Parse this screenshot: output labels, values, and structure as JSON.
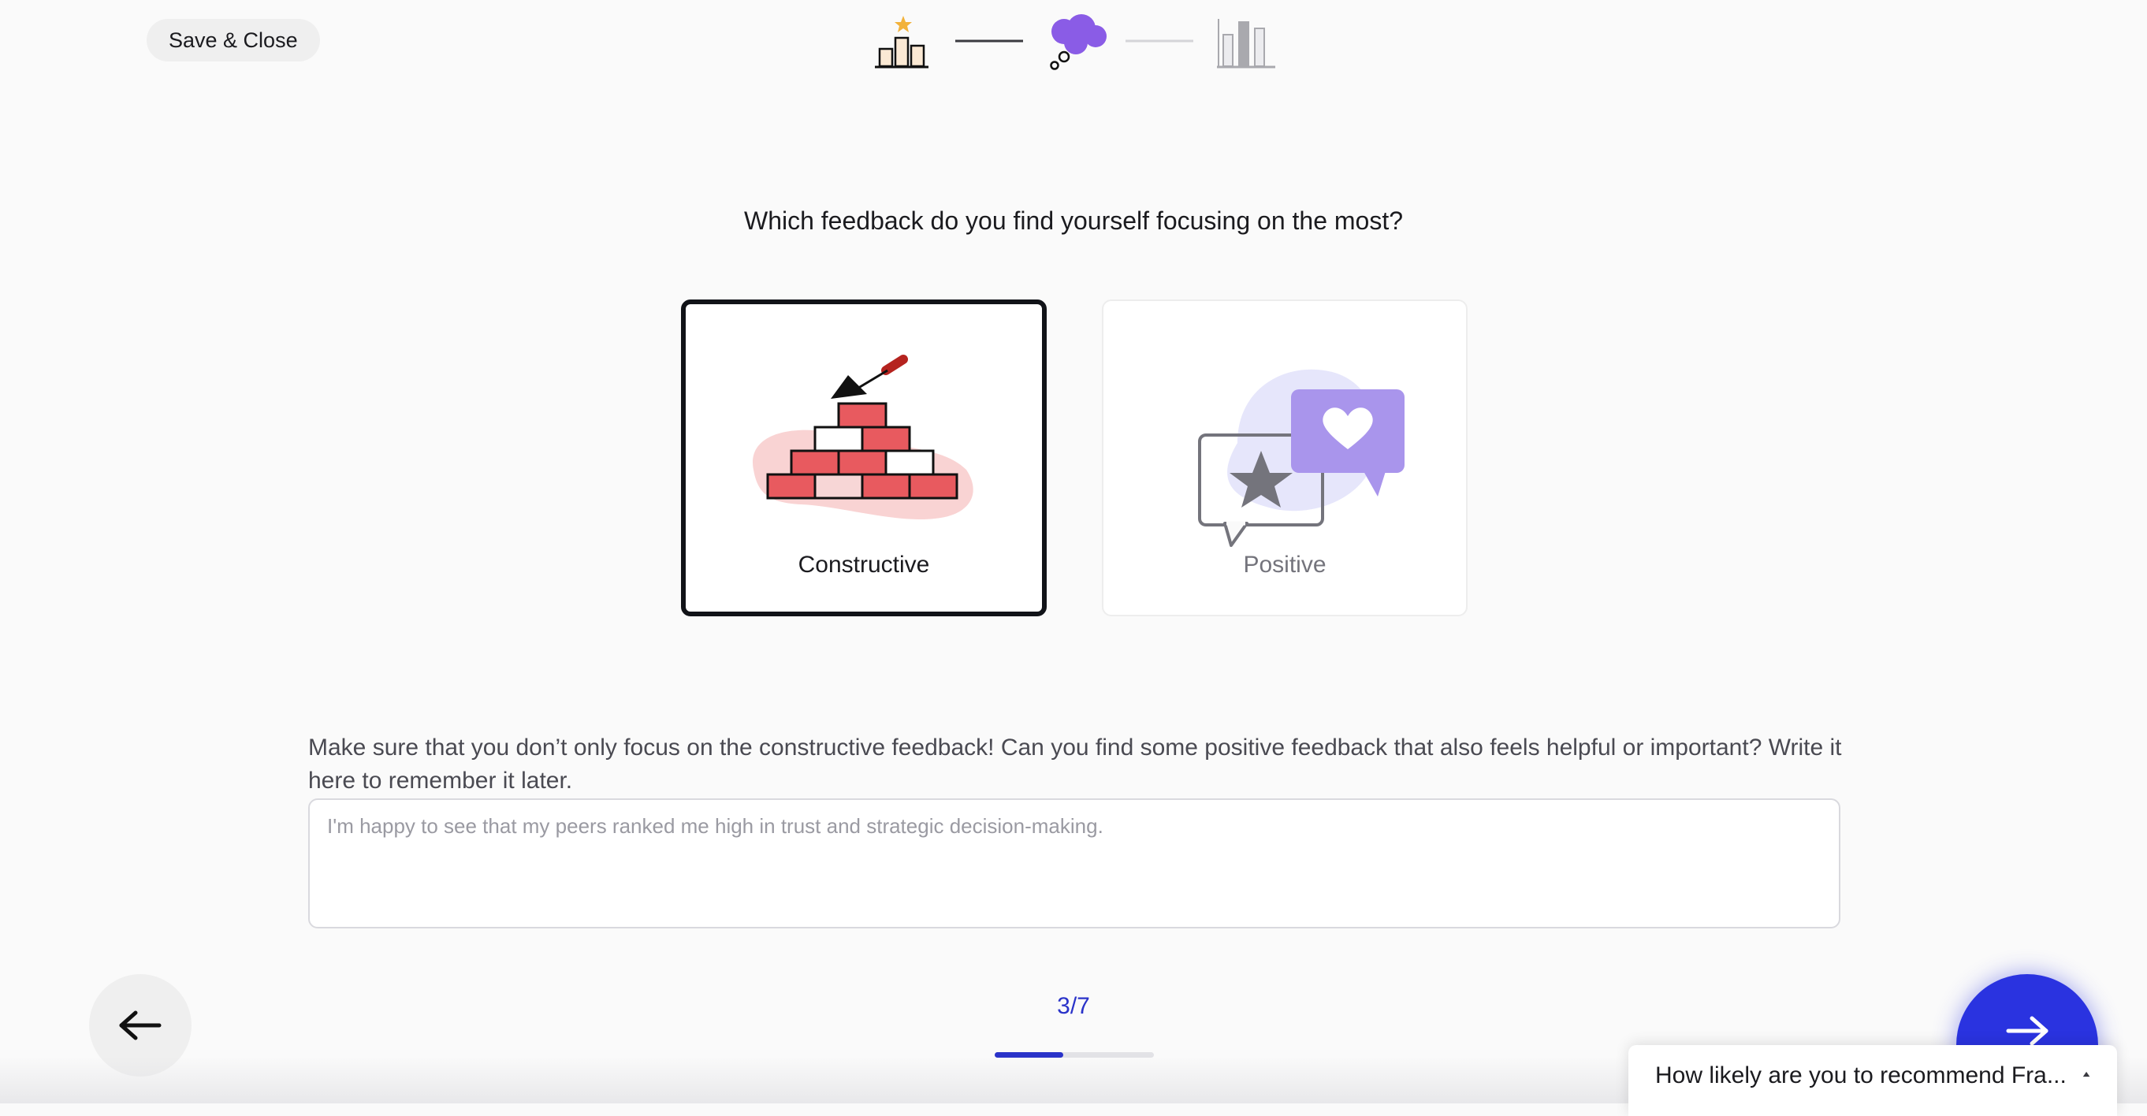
{
  "header": {
    "save_close_label": "Save & Close",
    "steps": [
      {
        "icon": "podium-star-icon",
        "state": "done"
      },
      {
        "icon": "thought-cloud-icon",
        "state": "current"
      },
      {
        "icon": "bar-chart-icon",
        "state": "upcoming"
      }
    ]
  },
  "question": "Which feedback do you find yourself focusing on the most?",
  "options": [
    {
      "label": "Constructive",
      "icon": "brick-wall-trowel-icon",
      "selected": true
    },
    {
      "label": "Positive",
      "icon": "chat-bubbles-star-heart-icon",
      "selected": false
    }
  ],
  "hint": "Make sure that you don’t only focus on the constructive feedback! Can you find some positive feedback that also feels helpful or important? Write it here to remember it later.",
  "note": {
    "value": "",
    "placeholder": "I'm happy to see that my peers ranked me high in trust and strategic decision-making."
  },
  "pagination": {
    "label": "3/7",
    "current": 3,
    "total": 7
  },
  "navigation": {
    "back_icon": "arrow-left-icon",
    "next_icon": "arrow-right-icon"
  },
  "survey": {
    "text": "How likely are you to recommend Fra...",
    "icon": "caret-up-icon"
  },
  "colors": {
    "accent": "#2a33e0",
    "brick_red": "#e85a5f",
    "purple": "#a78bea",
    "selected_border": "#111318"
  }
}
